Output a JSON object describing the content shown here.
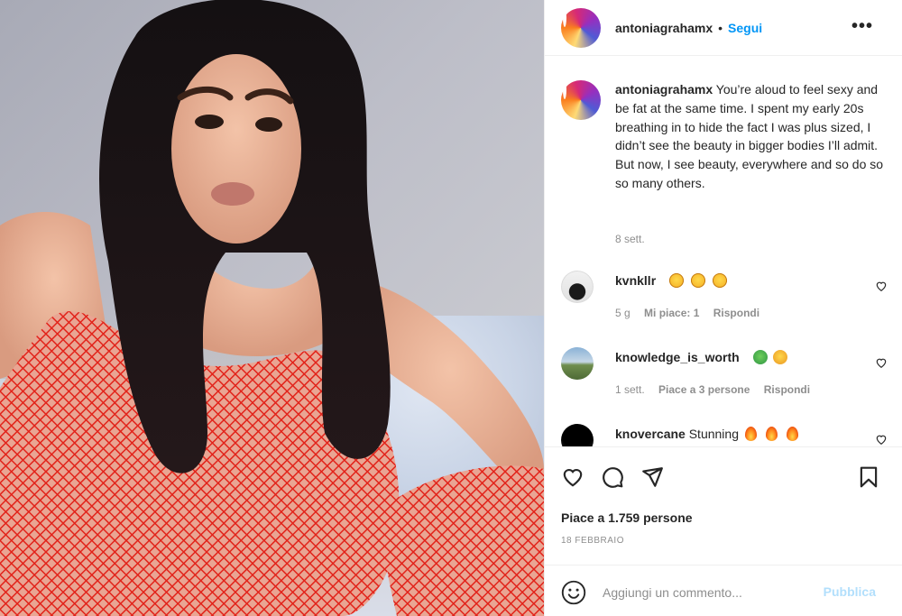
{
  "post": {
    "username": "antoniagrahamx",
    "dot": "•",
    "follow_label": "Segui",
    "more_label": "•••"
  },
  "caption": {
    "username": "antoniagrahamx",
    "text": "You’re aloud to feel sexy and be fat at the same time. I spent my early 20s breathing in to hide the fact I was plus sized, I didn’t see the beauty in bigger bodies I’ll admit. But now, I see beauty, everywhere and so do so so many others.",
    "time": "8 sett."
  },
  "comments": [
    {
      "username": "kvnkllr",
      "text": "",
      "emojis": [
        "laugh",
        "laugh",
        "laugh"
      ],
      "time": "5 g",
      "likes": "Mi piace: 1",
      "reply": "Rispondi"
    },
    {
      "username": "knowledge_is_worth",
      "text": "",
      "emojis": [
        "sick",
        "nausea"
      ],
      "time": "1 sett.",
      "likes": "Piace a 3 persone",
      "reply": "Rispondi"
    },
    {
      "username": "knovercane",
      "text": "Stunning",
      "emojis": [
        "fire",
        "fire",
        "fire"
      ],
      "time": "",
      "likes": "",
      "reply": ""
    }
  ],
  "actions": {
    "like_icon": "heart-icon",
    "comment_icon": "comment-icon",
    "share_icon": "paper-plane-icon",
    "save_icon": "bookmark-icon"
  },
  "likes_text": "Piace a 1.759 persone",
  "date": "18 FEBBRAIO",
  "add_comment": {
    "placeholder": "Aggiungi un commento...",
    "publish_label": "Pubblica",
    "emoji_icon": "smiley-icon"
  },
  "colors": {
    "accent": "#0095f6",
    "publish_disabled": "#b2dffc",
    "muted": "#8e8e8e",
    "text": "#262626",
    "border": "#efefef"
  }
}
